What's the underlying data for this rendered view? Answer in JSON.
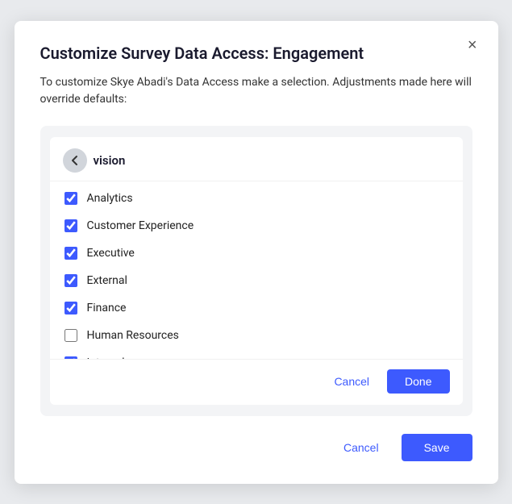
{
  "modal": {
    "title": "Customize Survey Data Access: Engagement",
    "description": "To customize Skye Abadi's Data Access make a selection. Adjustments made here will override defaults:",
    "close_label": "×"
  },
  "panel": {
    "heading": "vision",
    "back_label": "←",
    "items": [
      {
        "id": "analytics",
        "label": "Analytics",
        "checked": true
      },
      {
        "id": "customer-experience",
        "label": "Customer Experience",
        "checked": true
      },
      {
        "id": "executive",
        "label": "Executive",
        "checked": true
      },
      {
        "id": "external",
        "label": "External",
        "checked": true
      },
      {
        "id": "finance",
        "label": "Finance",
        "checked": true
      },
      {
        "id": "human-resources",
        "label": "Human Resources",
        "checked": false
      },
      {
        "id": "internal",
        "label": "Internal",
        "checked": true
      }
    ],
    "cancel_label": "Cancel",
    "done_label": "Done"
  },
  "footer": {
    "cancel_label": "Cancel",
    "save_label": "Save"
  }
}
